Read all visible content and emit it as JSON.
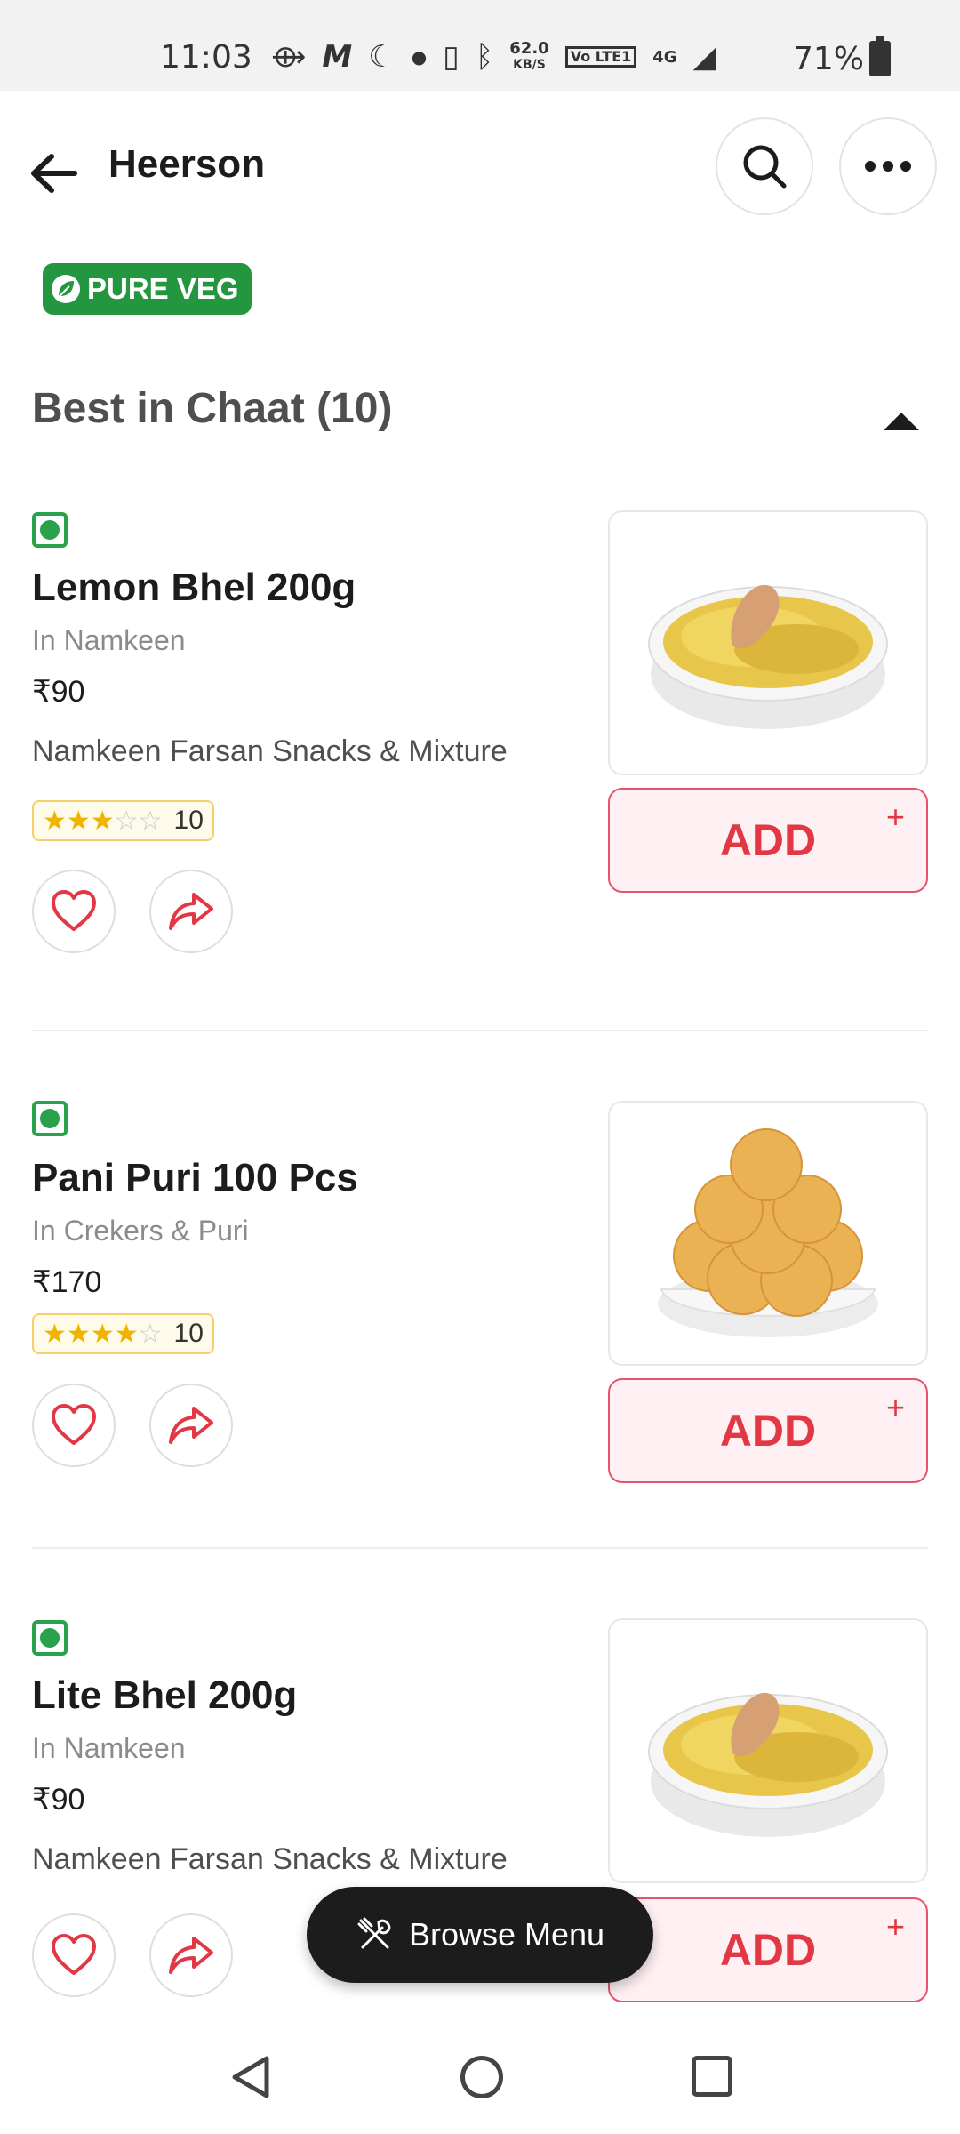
{
  "status_bar": {
    "time": "11:03",
    "speed_value": "62.0",
    "speed_unit": "KB/S",
    "volte": "Vo LTE1",
    "network": "4G",
    "battery": "71%"
  },
  "header": {
    "title": "Heerson"
  },
  "badge": {
    "label": "PURE VEG"
  },
  "section": {
    "title": "Best in Chaat (10)"
  },
  "items": [
    {
      "name": "Lemon Bhel 200g",
      "category": "In Namkeen",
      "price": "₹90",
      "description": "Namkeen Farsan Snacks & Mixture",
      "rating_stars": 3,
      "rating_count": "10",
      "add_label": "ADD",
      "image_icon": "bhel-bowl-image"
    },
    {
      "name": "Pani Puri 100 Pcs",
      "category": "In Crekers & Puri",
      "price": "₹170",
      "description": "",
      "rating_stars": 4,
      "rating_count": "10",
      "add_label": "ADD",
      "image_icon": "pani-puri-image"
    },
    {
      "name": "Lite Bhel 200g",
      "category": "In Namkeen",
      "price": "₹90",
      "description": "Namkeen Farsan Snacks & Mixture",
      "add_label": "ADD",
      "image_icon": "bhel-bowl-image"
    }
  ],
  "browse_menu": {
    "label": "Browse Menu"
  },
  "colors": {
    "brand_red": "#e23744",
    "veg_green": "#24963f",
    "star_gold": "#f0b400"
  }
}
